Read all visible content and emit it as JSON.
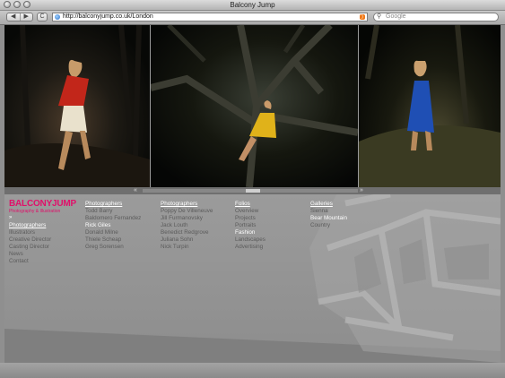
{
  "window": {
    "title": "Balcony Jump"
  },
  "toolbar": {
    "back": "◀",
    "forward": "▶",
    "reload": "C",
    "url": "http://balconyjump.co.uk/London",
    "rss": "RSS",
    "search_placeholder": "Google"
  },
  "photostrip": {
    "prev_arrow": "«",
    "next_arrow": "»"
  },
  "brand": {
    "logo": "BALCONYJUMP",
    "tagline": "Photography & Illustration",
    "marker": "»"
  },
  "leftnav": {
    "items": [
      "Photographers",
      "Illustrators",
      "Creative Director",
      "Casting Director",
      "News",
      "Contact"
    ]
  },
  "columns": [
    {
      "head": "Photographers",
      "items": [
        "Todd Barry",
        "Baldomero Fernandez",
        "Rick Giles",
        "Donald Milne",
        "Thiele Scheap",
        "Greg Sorensen"
      ],
      "active": 2
    },
    {
      "head": "Photographers",
      "items": [
        "Poppy De Villeneuve",
        "Jill Furmanovsky",
        "Jack Louth",
        "Benedict Redgrove",
        "Juliana Sohn",
        "Nick Turpin"
      ],
      "active": -1
    },
    {
      "head": "Folios",
      "items": [
        "Overview",
        "Projects",
        "Portraits",
        "Fashion",
        "Landscapes",
        "Advertising"
      ],
      "active": 3
    },
    {
      "head": "Galleries",
      "items": [
        "Sienna",
        "Bear Mountain",
        "Country"
      ],
      "active": 1
    }
  ]
}
